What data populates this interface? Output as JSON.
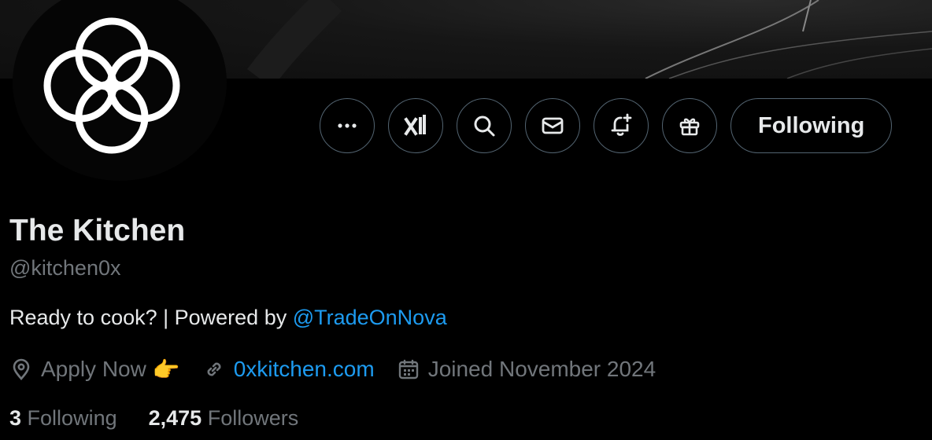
{
  "profile": {
    "display_name": "The Kitchen",
    "handle": "@kitchen0x",
    "bio_text": "Ready to cook? | Powered by ",
    "bio_mention": "@TradeOnNova"
  },
  "meta": {
    "location": "Apply Now",
    "location_emoji": "👉",
    "website": "0xkitchen.com",
    "joined": "Joined November 2024"
  },
  "stats": {
    "following_count": "3",
    "following_label": "Following",
    "followers_count": "2,475",
    "followers_label": "Followers"
  },
  "actions": {
    "follow_label": "Following",
    "icons": [
      "more-icon",
      "grok-icon",
      "search-icon",
      "message-icon",
      "notify-bell-icon",
      "gift-icon"
    ]
  },
  "colors": {
    "background": "#000000",
    "text": "#e7e9ea",
    "muted": "#71767b",
    "link": "#1d9bf0",
    "border": "#536471"
  }
}
